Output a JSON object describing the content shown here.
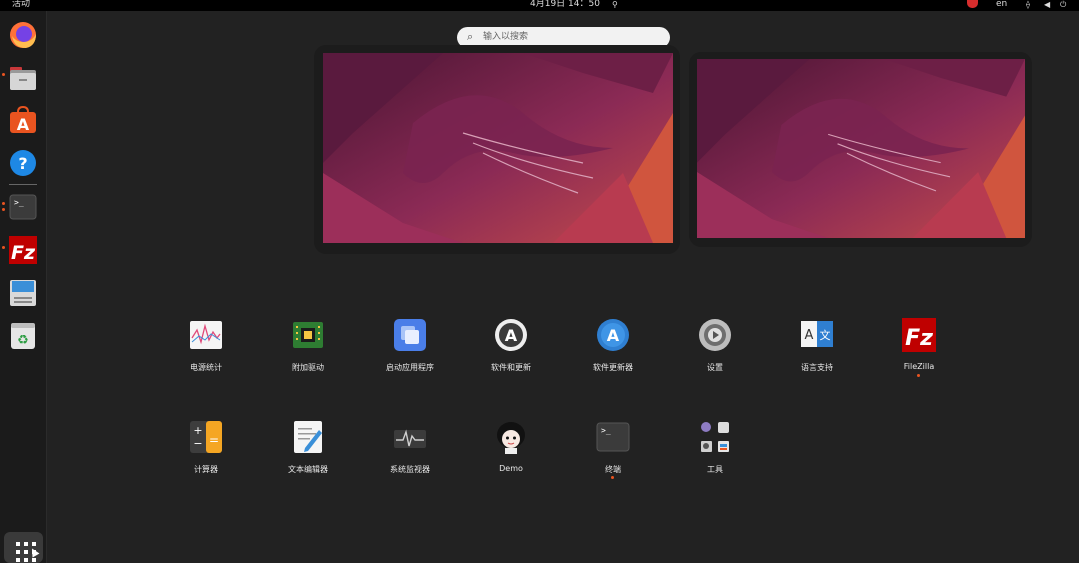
{
  "topbar": {
    "activities": "活动",
    "clock": "4月19日 14：50",
    "lang": "en"
  },
  "dock": {
    "items": [
      {
        "name": "firefox"
      },
      {
        "name": "files"
      },
      {
        "name": "app-center"
      },
      {
        "name": "help"
      },
      {
        "name": "terminal"
      },
      {
        "name": "filezilla"
      },
      {
        "name": "disk-installer"
      },
      {
        "name": "trash"
      }
    ]
  },
  "search": {
    "placeholder": "输入以搜索"
  },
  "apps": [
    {
      "label": "电源统计",
      "icon": "power-statistics-icon"
    },
    {
      "label": "附加驱动",
      "icon": "additional-drivers-icon"
    },
    {
      "label": "启动应用程序",
      "icon": "startup-applications-icon"
    },
    {
      "label": "软件和更新",
      "icon": "software-updates-icon"
    },
    {
      "label": "软件更新器",
      "icon": "software-updater-icon"
    },
    {
      "label": "设置",
      "icon": "settings-icon"
    },
    {
      "label": "语言支持",
      "icon": "language-support-icon"
    },
    {
      "label": "FileZilla",
      "icon": "filezilla-icon"
    },
    {
      "label": "计算器",
      "icon": "calculator-icon"
    },
    {
      "label": "文本编辑器",
      "icon": "text-editor-icon"
    },
    {
      "label": "系统监视器",
      "icon": "system-monitor-icon"
    },
    {
      "label": "Demo",
      "icon": "demo-avatar-icon"
    },
    {
      "label": "终端",
      "icon": "terminal-icon"
    },
    {
      "label": "工具",
      "icon": "utilities-folder-icon"
    }
  ],
  "colors": {
    "accent": "#e95420",
    "background": "#222222",
    "wallpaper_dark": "#5a1a3e",
    "wallpaper_light": "#c0396a"
  }
}
